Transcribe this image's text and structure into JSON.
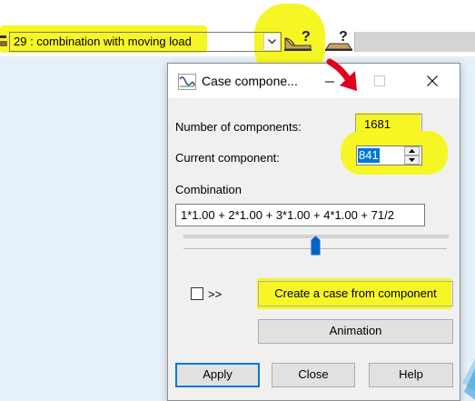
{
  "toolbar": {
    "case_combo_value": "29 : combination with moving load"
  },
  "dialog": {
    "title": "Case compone...",
    "number_of_components_label": "Number of components:",
    "number_of_components_value": "1681",
    "current_component_label": "Current component:",
    "current_component_value": "841",
    "combination_label": "Combination",
    "combination_value": "1*1.00 + 2*1.00 + 3*1.00 + 4*1.00 + 71/2",
    "slider_value_fraction": 0.5,
    "expand_label": ">>",
    "create_case_button": "Create a case from component",
    "animation_button": "Animation",
    "apply_button": "Apply",
    "close_button": "Close",
    "help_button": "Help"
  },
  "colors": {
    "highlight": "#f6f624",
    "annotation_arrow": "#e0001a",
    "selection": "#0078d7",
    "slider_thumb": "#0063c6"
  }
}
